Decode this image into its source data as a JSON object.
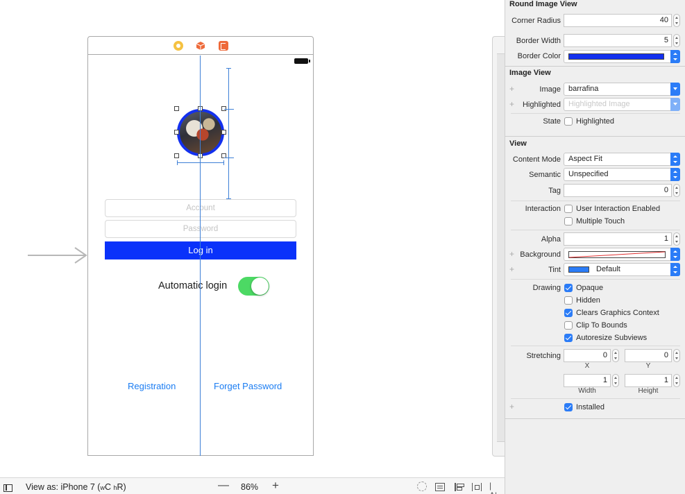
{
  "canvas": {
    "text_fields": {
      "account_placeholder": "Account",
      "password_placeholder": "Password"
    },
    "login_button_label": "Log in",
    "auto_login_label": "Automatic login",
    "auto_login_on": true,
    "registration_label": "Registration",
    "forget_password_label": "Forget Password",
    "image_border_color": "#1330EE",
    "button_color": "#0A32FA",
    "link_color": "#1A7CF2",
    "switch_color": "#4CD964"
  },
  "bottom_bar": {
    "view_as_prefix": "View as: iPhone 7 (",
    "size_class_w": "w",
    "size_class_w_value": "C",
    "size_class_h": "h",
    "size_class_h_value": "R",
    "view_as_suffix": ")",
    "zoom_out": "—",
    "zoom_level": "86%",
    "zoom_in": "+"
  },
  "inspector": {
    "round_image_view": {
      "title": "Round Image View",
      "corner_radius_label": "Corner Radius",
      "corner_radius": "40",
      "border_width_label": "Border Width",
      "border_width": "5",
      "border_color_label": "Border Color",
      "border_color": "#1330EE"
    },
    "image_view": {
      "title": "Image View",
      "image_label": "Image",
      "image_value": "barrafina",
      "highlighted_label": "Highlighted",
      "highlighted_placeholder": "Highlighted Image",
      "state_label": "State",
      "state_checkbox_label": "Highlighted",
      "state_checked": false
    },
    "view": {
      "title": "View",
      "content_mode_label": "Content Mode",
      "content_mode": "Aspect Fit",
      "semantic_label": "Semantic",
      "semantic": "Unspecified",
      "tag_label": "Tag",
      "tag": "0",
      "interaction_label": "Interaction",
      "user_interaction_label": "User Interaction Enabled",
      "multiple_touch_label": "Multiple Touch",
      "alpha_label": "Alpha",
      "alpha": "1",
      "background_label": "Background",
      "tint_label": "Tint",
      "tint_value": "Default",
      "tint_color": "#2B7CF7",
      "drawing_label": "Drawing",
      "opaque_label": "Opaque",
      "hidden_label": "Hidden",
      "clears_label": "Clears Graphics Context",
      "clip_label": "Clip To Bounds",
      "autoresize_label": "Autoresize Subviews",
      "stretching_label": "Stretching",
      "stretch_x": "0",
      "stretch_y": "0",
      "stretch_x_label": "X",
      "stretch_y_label": "Y",
      "stretch_width": "1",
      "stretch_height": "1",
      "stretch_width_label": "Width",
      "stretch_height_label": "Height",
      "installed_label": "Installed",
      "plus": "+"
    }
  }
}
